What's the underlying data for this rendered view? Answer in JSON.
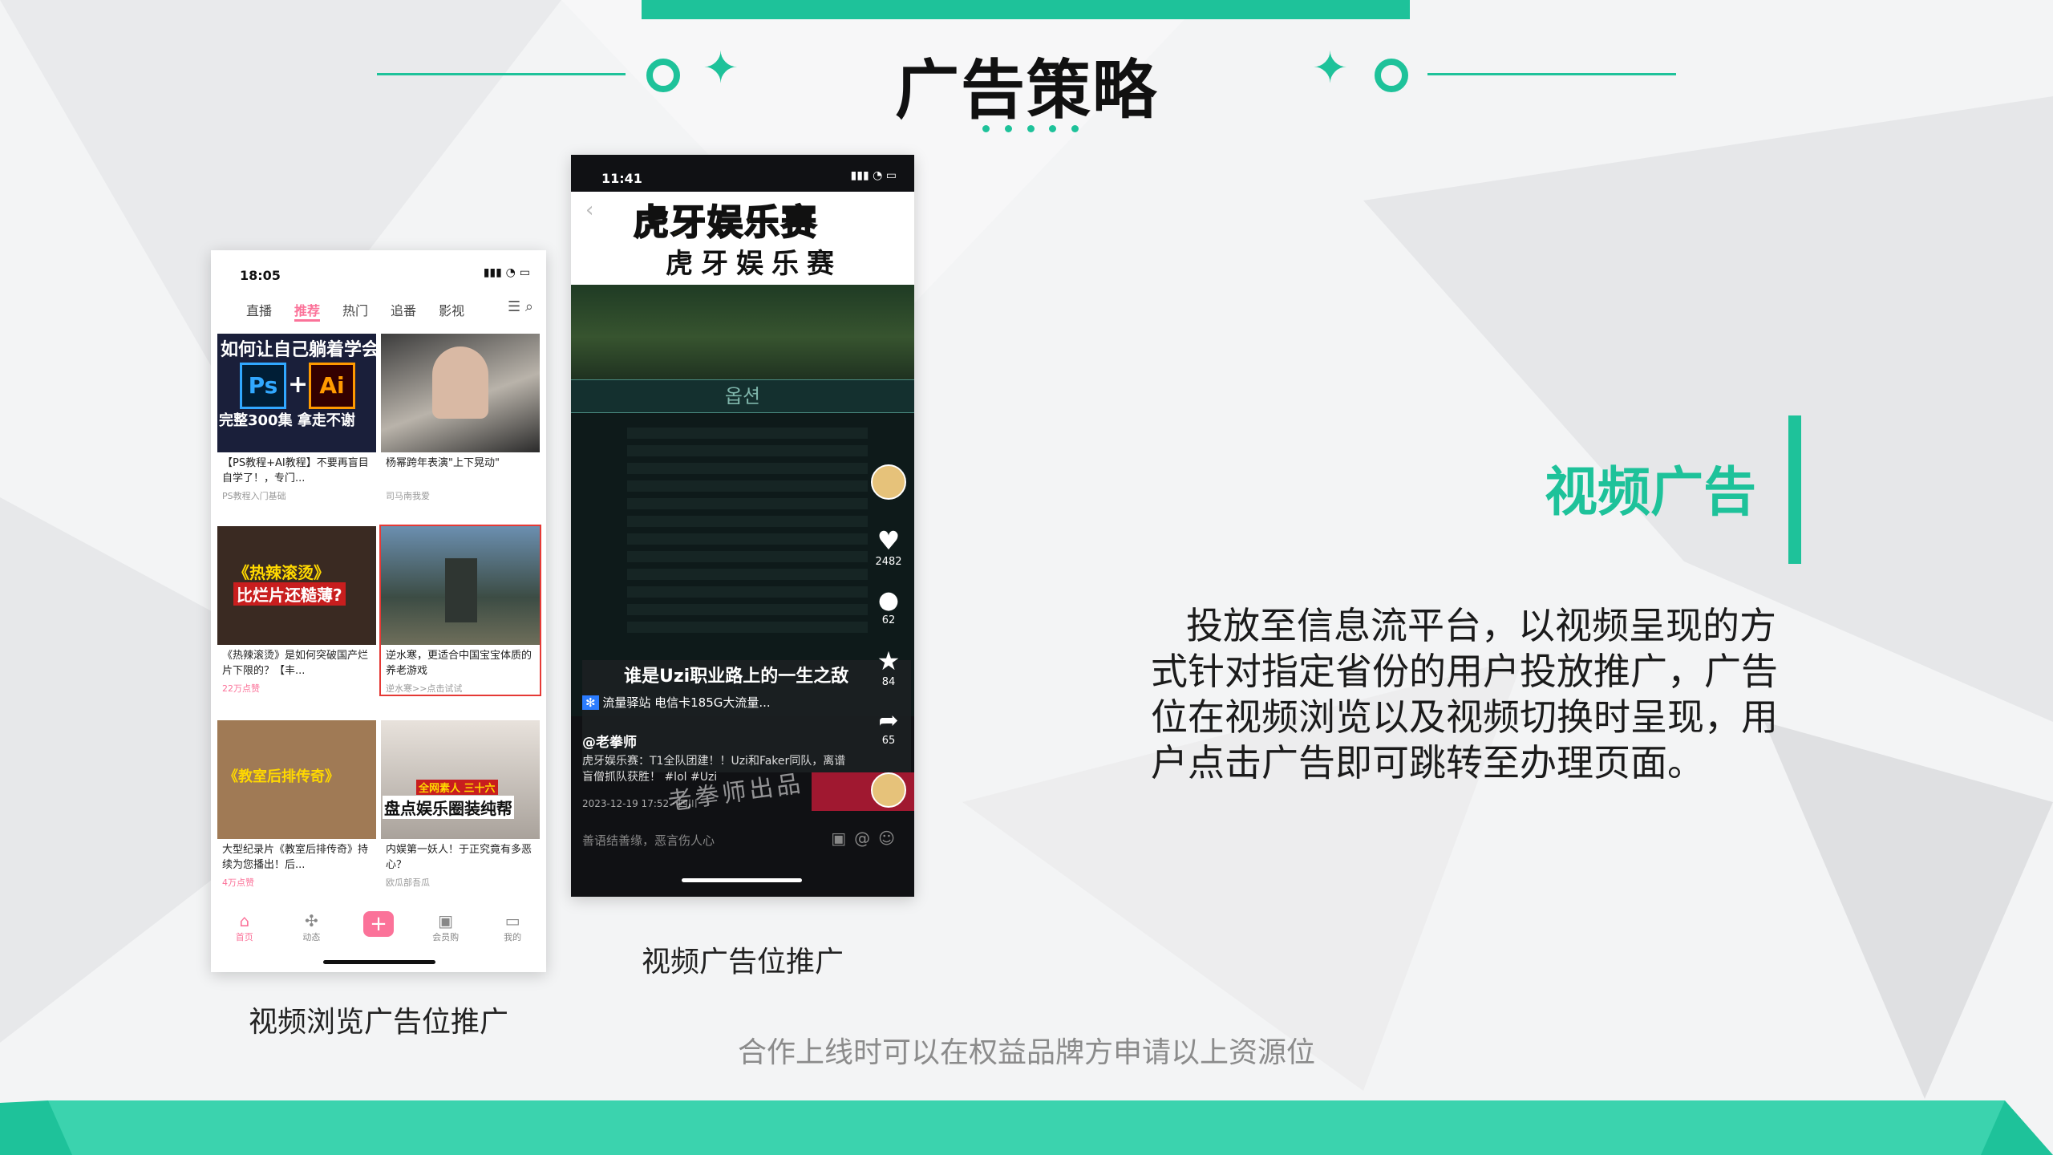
{
  "slide": {
    "title": "广告策略",
    "section_title": "视频广告",
    "paragraph": "投放至信息流平台，以视频呈现的方式针对指定省份的用户投放推广，广告位在视频浏览以及视频切换时呈现，用户点击广告即可跳转至办理页面。",
    "note": "合作上线时可以在权益品牌方申请以上资源位",
    "caption_left": "视频浏览广告位推广",
    "caption_right": "视频广告位推广",
    "colors": {
      "accent": "#1ec29a",
      "pink": "#fb7299"
    }
  },
  "phone1": {
    "time": "18:05",
    "tabs": [
      "直播",
      "推荐",
      "热门",
      "追番",
      "影视"
    ],
    "tiles": [
      {
        "overlay1": "如何让自己躺着学会",
        "overlay2": "完整300集  拿走不谢",
        "caption": "【PS教程+AI教程】不要再盲目自学了！，专门...",
        "meta": "PS教程入门基础"
      },
      {
        "overlay1": "",
        "overlay2": "",
        "caption": "杨幂跨年表演\"上下晃动\"",
        "meta": "司马南我爱"
      },
      {
        "overlay1": "《热辣滚烫》",
        "overlay2": "比烂片还糙薄?",
        "caption": "《热辣滚烫》是如何突破国产烂片下限的？【丰...",
        "meta": "22万点赞"
      },
      {
        "overlay1": "",
        "overlay2": "",
        "caption": "逆水寒，更适合中国宝宝体质的养老游戏",
        "meta": "逆水寒>>点击试试"
      },
      {
        "overlay1": "《教室后排传奇》",
        "overlay2": "",
        "caption": "大型纪录片《教室后排传奇》持续为您播出！后...",
        "meta": "4万点赞"
      },
      {
        "overlay1": "全网素人  三十六",
        "overlay2": "盘点娱乐圈装纯帮",
        "caption": "内娱第一妖人！于正究竟有多恶心？",
        "meta": "欧瓜部吾瓜"
      }
    ],
    "ps_label": "Ps",
    "ai_label": "Ai",
    "nav": [
      "首页",
      "动态",
      "会员购",
      "我的"
    ],
    "plus": "+"
  },
  "phone2": {
    "time": "11:41",
    "banner_top": "虎牙娱乐赛",
    "banner_sub": "虎牙娱乐赛",
    "game_word": "옵션",
    "likes": "2482",
    "comments": "62",
    "stars": "84",
    "shares": "65",
    "video_title": "谁是Uzi职业路上的一生之敌",
    "tag": "流量驿站  电信卡185G大流量...",
    "author": "@老拳师",
    "desc": "虎牙娱乐赛：T1全队团建！！Uzi和Faker同队，离谱盲僧抓队获胜！ #lol #Uzi",
    "date": "2023-12-19 17:52 · 四川",
    "watermark": "老拳师出品",
    "comment_placeholder": "善语结善缘，恶言伤人心"
  }
}
